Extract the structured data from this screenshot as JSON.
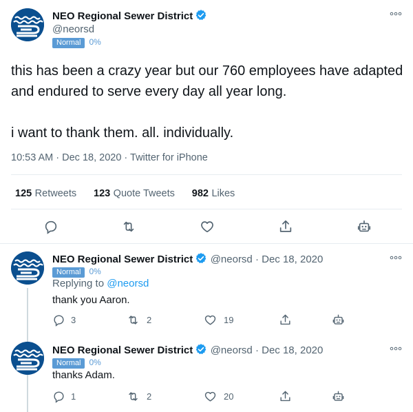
{
  "main": {
    "name": "NEO Regional Sewer District",
    "handle": "@neorsd",
    "badge": "Normal",
    "pct": "0%",
    "text": "this has been a crazy year but our 760 employees have adapted and endured to serve every day all year long.\n\ni want to thank them. all. individually.",
    "timestamp": "10:53 AM · Dec 18, 2020 · Twitter for iPhone",
    "retweets": "125",
    "retweets_label": "Retweets",
    "quotes": "123",
    "quotes_label": "Quote Tweets",
    "likes": "982",
    "likes_label": "Likes"
  },
  "replies": [
    {
      "name": "NEO Regional Sewer District",
      "handle_date": "@neorsd · Dec 18, 2020",
      "badge": "Normal",
      "pct": "0%",
      "replying_prefix": "Replying to ",
      "replying_to": "@neorsd",
      "text": "thank you Aaron.",
      "replies": "3",
      "retweets": "2",
      "likes": "19"
    },
    {
      "name": "NEO Regional Sewer District",
      "handle_date": "@neorsd · Dec 18, 2020",
      "badge": "Normal",
      "pct": "0%",
      "text": "thanks Adam.",
      "replies": "1",
      "retweets": "2",
      "likes": "20"
    }
  ],
  "icons": [
    "verified-icon",
    "more-icon",
    "reply-icon",
    "retweet-icon",
    "like-icon",
    "share-icon",
    "bot-icon"
  ],
  "colors": {
    "accent": "#1d9bf0",
    "badge": "#5b9bd5",
    "avatar": "#0b4f8f"
  }
}
